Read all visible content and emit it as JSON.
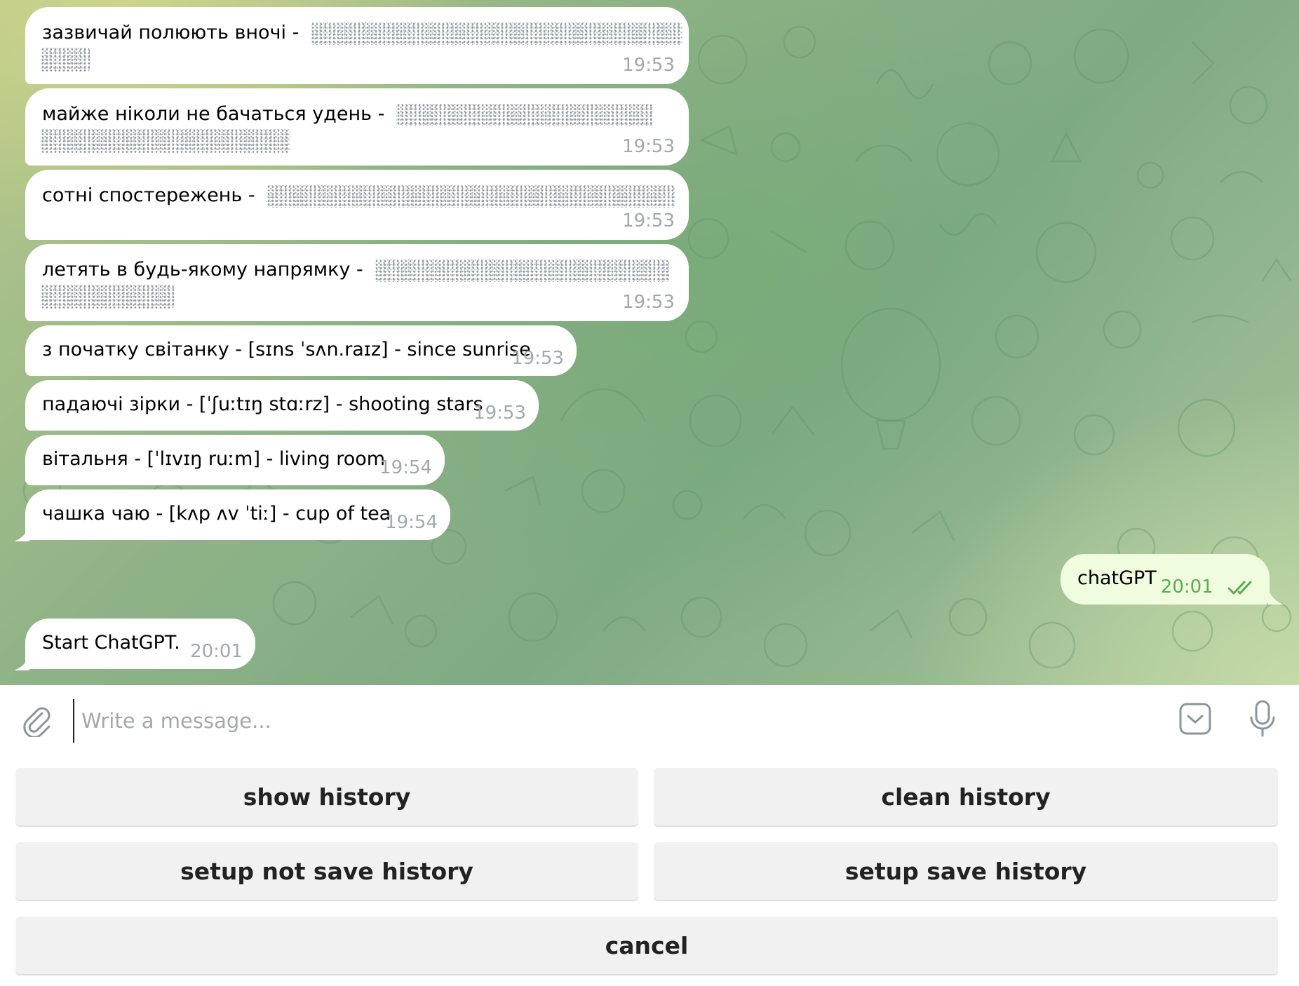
{
  "messages": [
    {
      "text": "зазвичай полюють вночі -",
      "time": "19:53"
    },
    {
      "text": "майже ніколи не бачаться удень -",
      "time": "19:53"
    },
    {
      "text": "сотні спостережень -",
      "time": "19:53"
    },
    {
      "text": "летять в будь-якому напрямку -",
      "time": "19:53"
    },
    {
      "text": "з початку світанку - [sɪns ˈsʌn.raɪz] - since sunrise",
      "time": "19:53"
    },
    {
      "text": "падаючі зірки - [ˈʃuːtɪŋ stɑːrz] - shooting stars",
      "time": "19:53"
    },
    {
      "text": "вітальня - [ˈlɪvɪŋ ruːm] - living room",
      "time": "19:54"
    },
    {
      "text": "чашка чаю - [kʌp ʌv ˈtiː] - cup of tea",
      "time": "19:54"
    },
    {
      "text": "chatGPT",
      "time": "20:01"
    },
    {
      "text": "Start ChatGPT.",
      "time": "20:01"
    }
  ],
  "composer": {
    "placeholder": "Write a message..."
  },
  "keyboard": {
    "show_history": "show history",
    "clean_history": "clean history",
    "setup_not_save": "setup not save history",
    "setup_save": "setup save history",
    "cancel": "cancel"
  },
  "icons": {
    "attach": "paperclip-icon",
    "bot_keyboard": "bot-keyboard-icon",
    "mic": "microphone-icon",
    "read_receipt": "double-check-icon"
  },
  "colors": {
    "outgoing_time": "#5aac4e",
    "incoming_time": "#a2a8b0",
    "outgoing_bubble": "#effdde",
    "keyboard_button": "#f1f1f2"
  }
}
